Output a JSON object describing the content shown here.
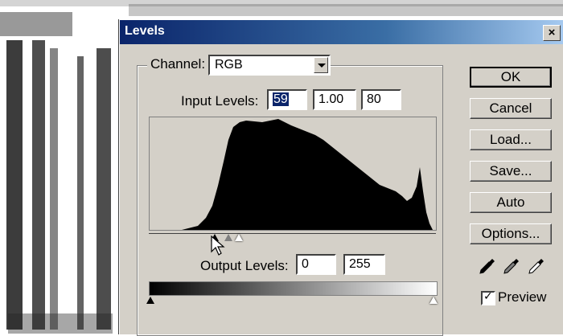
{
  "dialog": {
    "title": "Levels",
    "close_glyph": "×"
  },
  "channel": {
    "label": "Channel:",
    "selected": "RGB"
  },
  "input_levels": {
    "label": "Input Levels:",
    "black": "59",
    "gamma": "1.00",
    "white": "80"
  },
  "output_levels": {
    "label": "Output Levels:",
    "black": "0",
    "white": "255"
  },
  "buttons": {
    "ok": "OK",
    "cancel": "Cancel",
    "load": "Load...",
    "save": "Save...",
    "auto": "Auto",
    "options": "Options..."
  },
  "preview": {
    "label": "Preview",
    "checked": true
  },
  "icons": [
    "close-icon",
    "chevron-down-icon",
    "black-eyedropper-icon",
    "gray-eyedropper-icon",
    "white-eyedropper-icon",
    "mouse-cursor-icon",
    "checkmark-icon"
  ],
  "colors": {
    "dialog_bg": "#d4d0c8",
    "titlebar_start": "#0a246a",
    "titlebar_end": "#a6caf0",
    "selection": "#0a246a"
  }
}
